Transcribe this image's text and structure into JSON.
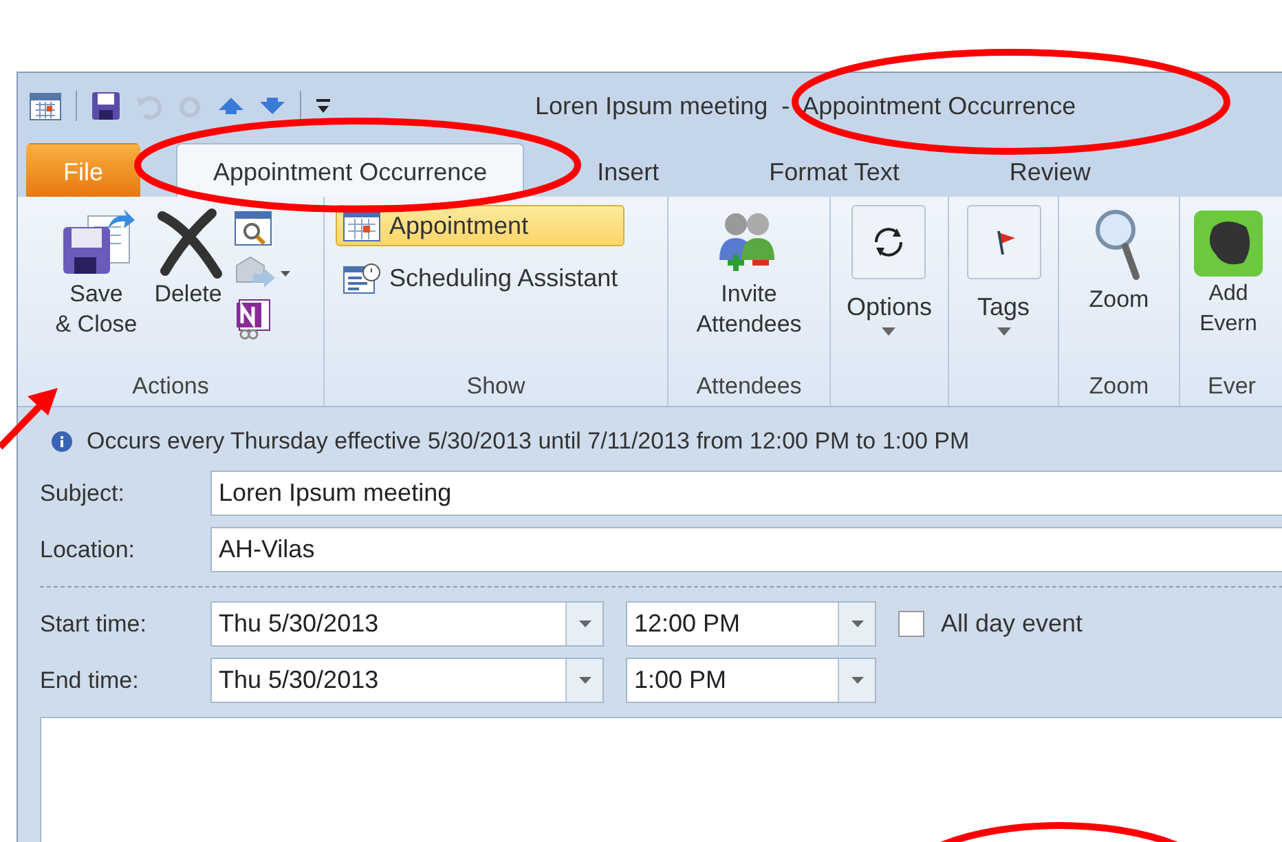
{
  "window": {
    "title": "Loren Ipsum meeting  -  Appointment Occurrence"
  },
  "tabs": [
    {
      "label": "File",
      "kind": "file",
      "selected": false
    },
    {
      "label": "Appointment Occurrence",
      "kind": "tab",
      "selected": true
    },
    {
      "label": "Insert",
      "kind": "tab",
      "selected": false
    },
    {
      "label": "Format Text",
      "kind": "tab",
      "selected": false
    },
    {
      "label": "Review",
      "kind": "tab",
      "selected": false
    }
  ],
  "ribbon": {
    "groups": [
      {
        "label": "Actions",
        "buttons": [
          {
            "label": "Save & Close"
          },
          {
            "label": "Delete"
          }
        ]
      },
      {
        "label": "Show",
        "buttons": [
          {
            "label": "Appointment",
            "selected": true
          },
          {
            "label": "Scheduling Assistant",
            "selected": false
          }
        ]
      },
      {
        "label": "Attendees",
        "buttons": [
          {
            "label": "Invite Attendees"
          }
        ]
      },
      {
        "buttons": [
          {
            "label": "Options"
          }
        ]
      },
      {
        "buttons": [
          {
            "label": "Tags"
          }
        ]
      },
      {
        "label": "Zoom",
        "buttons": [
          {
            "label": "Zoom"
          }
        ]
      },
      {
        "label": "Ever",
        "buttons": [
          {
            "label": "Add Evern"
          }
        ]
      }
    ]
  },
  "info": "Occurs every Thursday effective 5/30/2013 until 7/11/2013 from 12:00 PM to 1:00 PM",
  "form": {
    "subject": {
      "label": "Subject:",
      "value": "Loren Ipsum meeting"
    },
    "location": {
      "label": "Location:",
      "value": "AH-Vilas"
    },
    "start": {
      "label": "Start time:",
      "date": "Thu 5/30/2013",
      "time": "12:00 PM"
    },
    "end": {
      "label": "End time:",
      "date": "Thu 5/30/2013",
      "time": "1:00 PM"
    },
    "all_day": {
      "label": "All day event",
      "checked": false
    }
  }
}
